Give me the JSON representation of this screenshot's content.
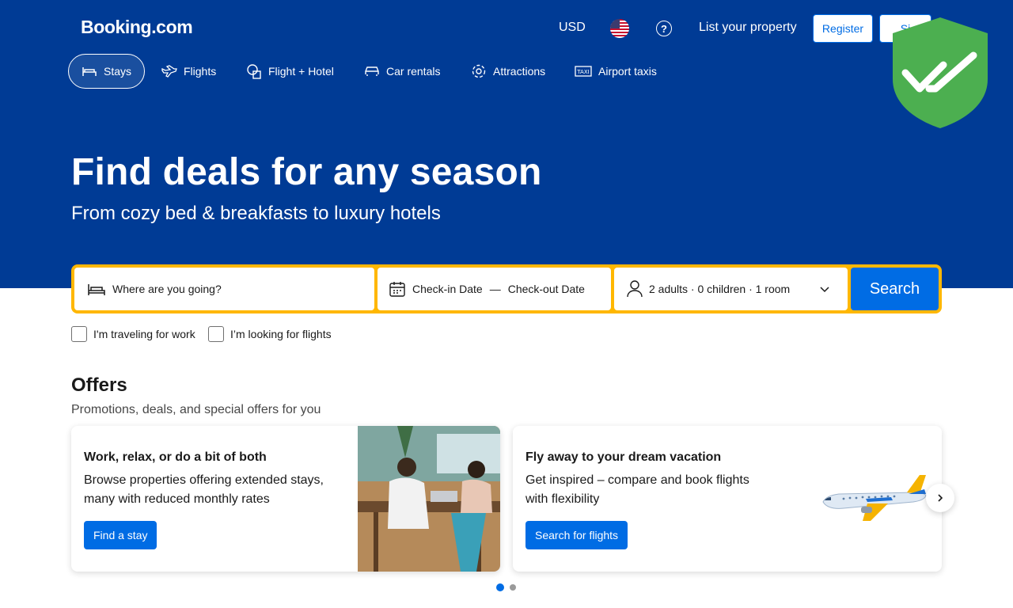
{
  "header": {
    "logo": "Booking.com",
    "currency": "USD",
    "list_property": "List your property",
    "register": "Register",
    "sign_in": "Si"
  },
  "nav": {
    "items": [
      {
        "label": "Stays",
        "icon": "bed-icon",
        "active": true
      },
      {
        "label": "Flights",
        "icon": "plane-icon",
        "active": false
      },
      {
        "label": "Flight + Hotel",
        "icon": "flight-hotel-icon",
        "active": false
      },
      {
        "label": "Car rentals",
        "icon": "car-icon",
        "active": false
      },
      {
        "label": "Attractions",
        "icon": "attractions-icon",
        "active": false
      },
      {
        "label": "Airport taxis",
        "icon": "taxi-icon",
        "active": false
      }
    ]
  },
  "hero": {
    "title": "Find deals for any season",
    "subtitle": "From cozy bed & breakfasts to luxury hotels"
  },
  "search": {
    "destination_placeholder": "Where are you going?",
    "checkin": "Check-in Date",
    "separator": "—",
    "checkout": "Check-out Date",
    "guests": "2 adults · 0 children · 1 room",
    "button": "Search"
  },
  "options": {
    "work_travel": "I'm traveling for work",
    "flights": "I’m looking for flights"
  },
  "offers": {
    "title": "Offers",
    "subtitle": "Promotions, deals, and special offers for you",
    "cards": [
      {
        "title": "Work, relax, or do a bit of both",
        "text": "Browse properties offering extended stays, many with reduced monthly rates",
        "button": "Find a stay"
      },
      {
        "title": "Fly away to your dream vacation",
        "text": "Get inspired – compare and book flights with flexibility",
        "button": "Search for flights"
      }
    ]
  },
  "carousel": {
    "active_page": 1,
    "pages": 2
  },
  "colors": {
    "brand_blue": "#003b95",
    "action_blue": "#006ce4",
    "search_border": "#ffb700",
    "shield_green": "#4caf50"
  }
}
